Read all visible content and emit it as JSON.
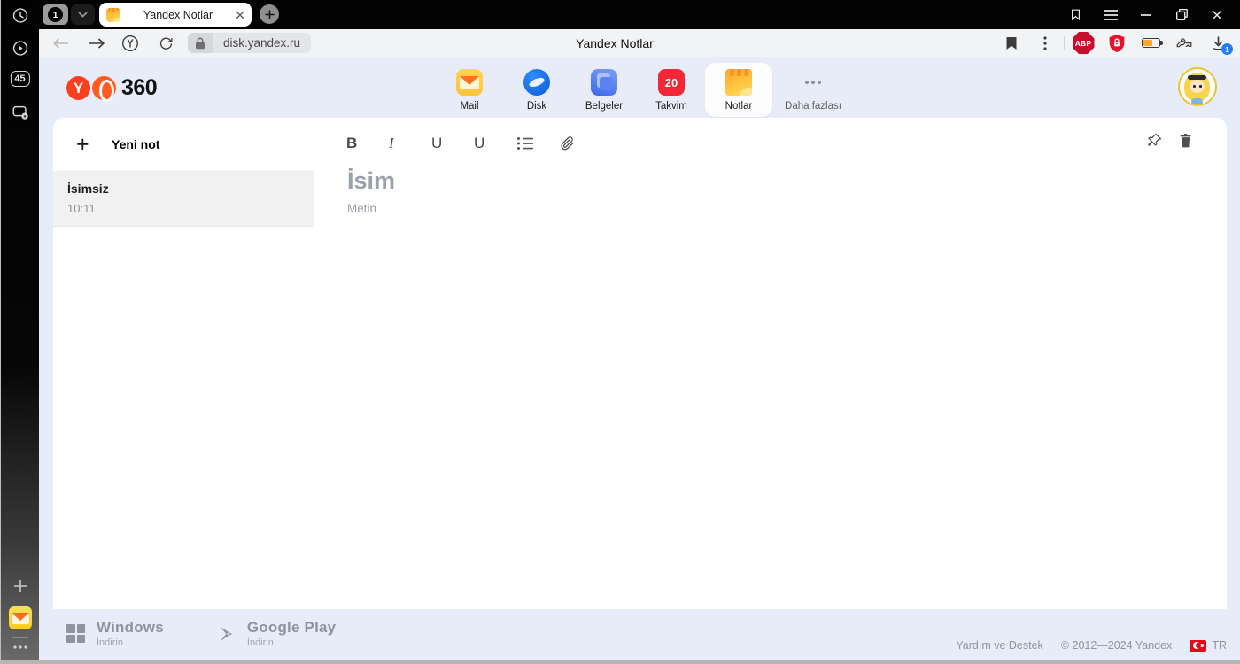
{
  "browser": {
    "sidebar": {
      "counter_badge": "45"
    },
    "tabbar": {
      "group_count": "1",
      "tab_title": "Yandex Notlar"
    },
    "addressbar": {
      "url": "disk.yandex.ru",
      "page_title": "Yandex Notlar",
      "abp_label": "ABP",
      "downloads_badge": "1"
    }
  },
  "header": {
    "logo_y": "Y",
    "logo_text": "360",
    "apps": [
      {
        "label": "Mail"
      },
      {
        "label": "Disk"
      },
      {
        "label": "Belgeler"
      },
      {
        "label": "Takvim",
        "badge": "20"
      },
      {
        "label": "Notlar"
      },
      {
        "label": "Daha fazlası"
      }
    ]
  },
  "notes_panel": {
    "plus": "+",
    "new_note_label": "Yeni not",
    "items": [
      {
        "title": "İsimsiz",
        "time": "10:11"
      }
    ]
  },
  "editor": {
    "toolbar": {
      "bold": "B",
      "italic": "I",
      "underline": "U",
      "strike": "U"
    },
    "title_placeholder": "İsim",
    "body_placeholder": "Metin"
  },
  "footer": {
    "windows": {
      "title": "Windows",
      "subtitle": "İndirin"
    },
    "google_play": {
      "title": "Google Play",
      "subtitle": "İndirin"
    },
    "help_link": "Yardım ve Destek",
    "copyright": "© 2012—2024 Yandex",
    "language": "TR"
  },
  "colors": {
    "yandex_red": "#fc3f1d",
    "page_background": "#e8ecf9",
    "takvim_red": "#f32735",
    "download_badge_blue": "#1f7df8",
    "abp_red": "#c70d2c",
    "notes_accent_orange": "#ffb63d"
  }
}
